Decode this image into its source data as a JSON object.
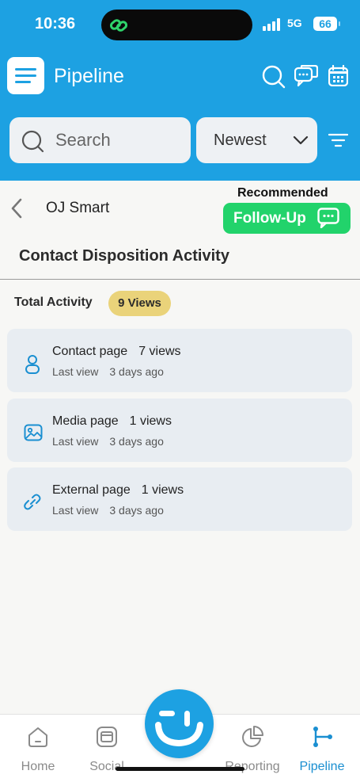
{
  "status_bar": {
    "time": "10:36",
    "network": "5G",
    "battery": "66"
  },
  "header": {
    "title": "Pipeline"
  },
  "search": {
    "placeholder": "Search"
  },
  "sort": {
    "selected": "Newest"
  },
  "contact": {
    "name": "OJ Smart"
  },
  "recommendation": {
    "label": "Recommended",
    "button_label": "Follow-Up"
  },
  "section": {
    "title": "Contact Disposition Activity"
  },
  "total": {
    "label": "Total Activity",
    "badge": "9 Views"
  },
  "activities": [
    {
      "title": "Contact page",
      "count": "7 views",
      "last_label": "Last view",
      "ago": "3 days ago",
      "icon": "person-icon"
    },
    {
      "title": "Media page",
      "count": "1 views",
      "last_label": "Last view",
      "ago": "3 days ago",
      "icon": "image-icon"
    },
    {
      "title": "External page",
      "count": "1 views",
      "last_label": "Last view",
      "ago": "3 days ago",
      "icon": "link-icon"
    }
  ],
  "nav": {
    "items": [
      {
        "label": "Home",
        "icon": "home-icon"
      },
      {
        "label": "Social",
        "icon": "social-icon"
      },
      {
        "label": "Reporting",
        "icon": "pie-chart-icon"
      },
      {
        "label": "Pipeline",
        "icon": "pipeline-icon"
      }
    ],
    "active": "Pipeline"
  },
  "colors": {
    "brand": "#1da1e2",
    "accent_green": "#22d36b",
    "badge": "#ead37a",
    "card": "#e8edf2",
    "active_nav": "#1a8fd1"
  }
}
